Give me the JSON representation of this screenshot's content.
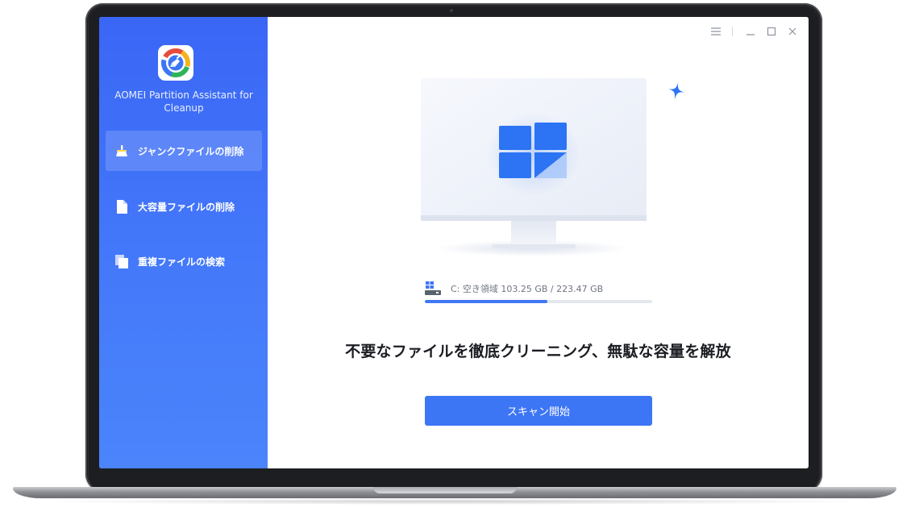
{
  "app": {
    "name": "AOMEI Partition Assistant for Cleanup"
  },
  "sidebar": {
    "items": [
      {
        "label": "ジャンクファイルの削除",
        "icon": "broom-icon",
        "active": true
      },
      {
        "label": "大容量ファイルの削除",
        "icon": "file-icon",
        "active": false
      },
      {
        "label": "重複ファイルの検索",
        "icon": "duplicate-files-icon",
        "active": false
      }
    ]
  },
  "window_controls": [
    "menu-icon",
    "minimize-icon",
    "maximize-icon",
    "close-icon"
  ],
  "drive": {
    "text": "C: 空き領域 103.25 GB / 223.47 GB",
    "free_gb": 103.25,
    "total_gb": 223.47,
    "bar_fill_fraction": 0.54
  },
  "main": {
    "headline": "不要なファイルを徹底クリーニング、無駄な容量を解放",
    "scan_button": "スキャン開始"
  },
  "colors": {
    "accent": "#3d76f5",
    "sidebar_top": "#3a66f5",
    "sidebar_bottom": "#4b84fb",
    "text_dark": "#1b1d22"
  }
}
